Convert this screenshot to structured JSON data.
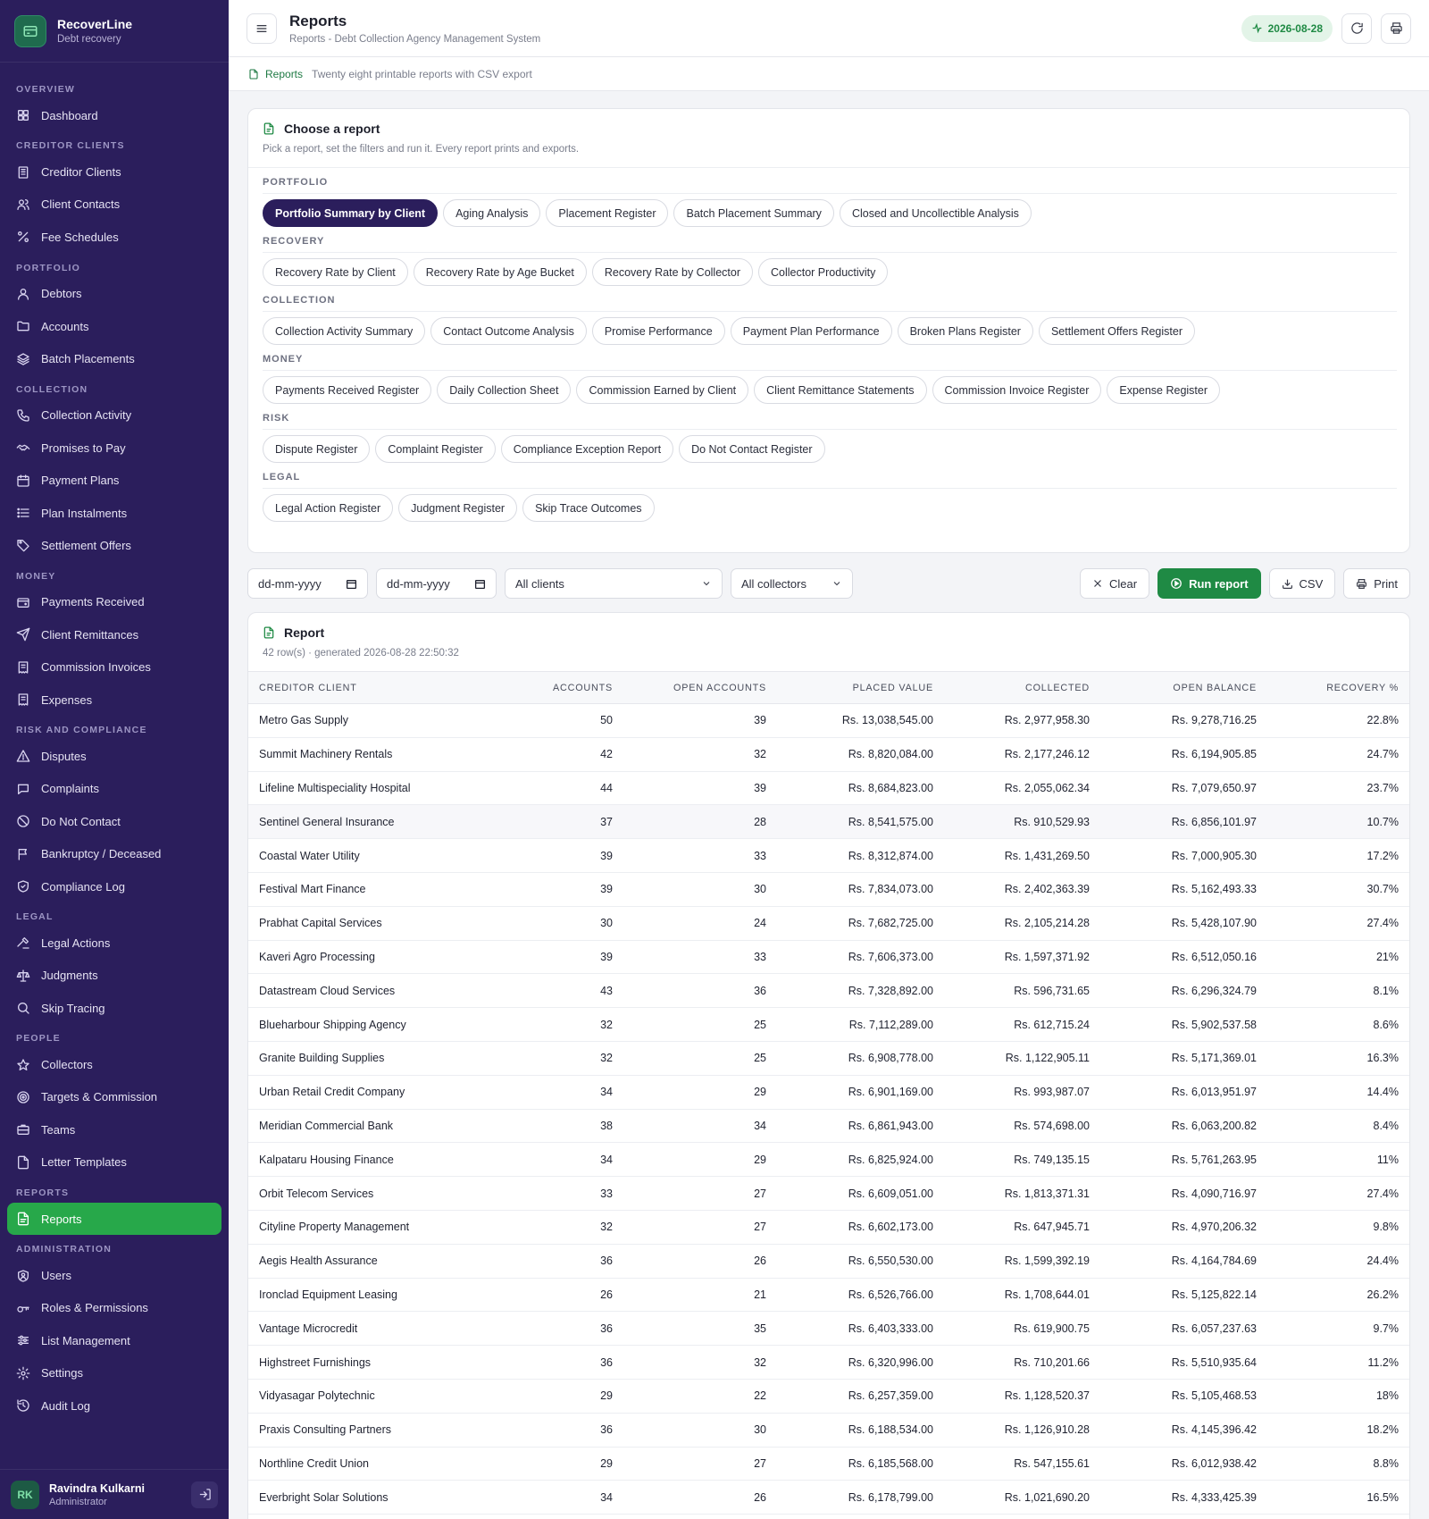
{
  "brand": {
    "name": "RecoverLine",
    "sub": "Debt recovery"
  },
  "nav": [
    {
      "section": "OVERVIEW",
      "items": [
        {
          "label": "Dashboard",
          "icon": "grid-icon"
        }
      ]
    },
    {
      "section": "CREDITOR CLIENTS",
      "items": [
        {
          "label": "Creditor Clients",
          "icon": "building-icon"
        },
        {
          "label": "Client Contacts",
          "icon": "users-icon"
        },
        {
          "label": "Fee Schedules",
          "icon": "percent-icon"
        }
      ]
    },
    {
      "section": "PORTFOLIO",
      "items": [
        {
          "label": "Debtors",
          "icon": "user-icon"
        },
        {
          "label": "Accounts",
          "icon": "folder-icon"
        },
        {
          "label": "Batch Placements",
          "icon": "layers-icon"
        }
      ]
    },
    {
      "section": "COLLECTION",
      "items": [
        {
          "label": "Collection Activity",
          "icon": "phone-icon"
        },
        {
          "label": "Promises to Pay",
          "icon": "handshake-icon"
        },
        {
          "label": "Payment Plans",
          "icon": "calendar-icon"
        },
        {
          "label": "Plan Instalments",
          "icon": "list-icon"
        },
        {
          "label": "Settlement Offers",
          "icon": "tag-icon"
        }
      ]
    },
    {
      "section": "MONEY",
      "items": [
        {
          "label": "Payments Received",
          "icon": "wallet-icon"
        },
        {
          "label": "Client Remittances",
          "icon": "send-icon"
        },
        {
          "label": "Commission Invoices",
          "icon": "receipt-icon"
        },
        {
          "label": "Expenses",
          "icon": "receipt-icon"
        }
      ]
    },
    {
      "section": "RISK AND COMPLIANCE",
      "items": [
        {
          "label": "Disputes",
          "icon": "alert-triangle-icon"
        },
        {
          "label": "Complaints",
          "icon": "message-icon"
        },
        {
          "label": "Do Not Contact",
          "icon": "ban-icon"
        },
        {
          "label": "Bankruptcy / Deceased",
          "icon": "flag-icon"
        },
        {
          "label": "Compliance Log",
          "icon": "shield-icon"
        }
      ]
    },
    {
      "section": "LEGAL",
      "items": [
        {
          "label": "Legal Actions",
          "icon": "gavel-icon"
        },
        {
          "label": "Judgments",
          "icon": "scale-icon"
        },
        {
          "label": "Skip Tracing",
          "icon": "search-icon"
        }
      ]
    },
    {
      "section": "PEOPLE",
      "items": [
        {
          "label": "Collectors",
          "icon": "star-icon"
        },
        {
          "label": "Targets & Commission",
          "icon": "target-icon"
        },
        {
          "label": "Teams",
          "icon": "briefcase-icon"
        },
        {
          "label": "Letter Templates",
          "icon": "file-icon"
        }
      ]
    },
    {
      "section": "REPORTS",
      "items": [
        {
          "label": "Reports",
          "icon": "report-icon",
          "active": true
        }
      ]
    },
    {
      "section": "ADMINISTRATION",
      "items": [
        {
          "label": "Users",
          "icon": "user-shield-icon"
        },
        {
          "label": "Roles & Permissions",
          "icon": "key-icon"
        },
        {
          "label": "List Management",
          "icon": "sliders-icon"
        },
        {
          "label": "Settings",
          "icon": "gear-icon"
        },
        {
          "label": "Audit Log",
          "icon": "history-icon"
        }
      ]
    }
  ],
  "user": {
    "initials": "RK",
    "name": "Ravindra Kulkarni",
    "role": "Administrator"
  },
  "header": {
    "title": "Reports",
    "subtitle": "Reports - Debt Collection Agency Management System",
    "date": "2026-08-28"
  },
  "crumb": {
    "section": "Reports",
    "desc": "Twenty eight printable reports with CSV export"
  },
  "chooser": {
    "title": "Choose a report",
    "subtitle": "Pick a report, set the filters and run it. Every report prints and exports.",
    "groups": [
      {
        "label": "PORTFOLIO",
        "reports": [
          "Portfolio Summary by Client",
          "Aging Analysis",
          "Placement Register",
          "Batch Placement Summary",
          "Closed and Uncollectible Analysis"
        ]
      },
      {
        "label": "RECOVERY",
        "reports": [
          "Recovery Rate by Client",
          "Recovery Rate by Age Bucket",
          "Recovery Rate by Collector",
          "Collector Productivity"
        ]
      },
      {
        "label": "COLLECTION",
        "reports": [
          "Collection Activity Summary",
          "Contact Outcome Analysis",
          "Promise Performance",
          "Payment Plan Performance",
          "Broken Plans Register",
          "Settlement Offers Register"
        ]
      },
      {
        "label": "MONEY",
        "reports": [
          "Payments Received Register",
          "Daily Collection Sheet",
          "Commission Earned by Client",
          "Client Remittance Statements",
          "Commission Invoice Register",
          "Expense Register"
        ]
      },
      {
        "label": "RISK",
        "reports": [
          "Dispute Register",
          "Complaint Register",
          "Compliance Exception Report",
          "Do Not Contact Register"
        ]
      },
      {
        "label": "LEGAL",
        "reports": [
          "Legal Action Register",
          "Judgment Register",
          "Skip Trace Outcomes"
        ]
      }
    ],
    "selected": "Portfolio Summary by Client"
  },
  "filters": {
    "from_placeholder": "dd-mm-yyyy",
    "to_placeholder": "dd-mm-yyyy",
    "client": "All clients",
    "collector": "All collectors",
    "clear": "Clear",
    "run": "Run report",
    "csv": "CSV",
    "print": "Print"
  },
  "report": {
    "title": "Report",
    "meta": "42 row(s) · generated 2026-08-28 22:50:32",
    "columns": [
      "CREDITOR CLIENT",
      "ACCOUNTS",
      "OPEN ACCOUNTS",
      "PLACED VALUE",
      "COLLECTED",
      "OPEN BALANCE",
      "RECOVERY %"
    ],
    "rows": [
      [
        "Metro Gas Supply",
        "50",
        "39",
        "Rs. 13,038,545.00",
        "Rs. 2,977,958.30",
        "Rs. 9,278,716.25",
        "22.8%"
      ],
      [
        "Summit Machinery Rentals",
        "42",
        "32",
        "Rs. 8,820,084.00",
        "Rs. 2,177,246.12",
        "Rs. 6,194,905.85",
        "24.7%"
      ],
      [
        "Lifeline Multispeciality Hospital",
        "44",
        "39",
        "Rs. 8,684,823.00",
        "Rs. 2,055,062.34",
        "Rs. 7,079,650.97",
        "23.7%"
      ],
      [
        "Sentinel General Insurance",
        "37",
        "28",
        "Rs. 8,541,575.00",
        "Rs. 910,529.93",
        "Rs. 6,856,101.97",
        "10.7%"
      ],
      [
        "Coastal Water Utility",
        "39",
        "33",
        "Rs. 8,312,874.00",
        "Rs. 1,431,269.50",
        "Rs. 7,000,905.30",
        "17.2%"
      ],
      [
        "Festival Mart Finance",
        "39",
        "30",
        "Rs. 7,834,073.00",
        "Rs. 2,402,363.39",
        "Rs. 5,162,493.33",
        "30.7%"
      ],
      [
        "Prabhat Capital Services",
        "30",
        "24",
        "Rs. 7,682,725.00",
        "Rs. 2,105,214.28",
        "Rs. 5,428,107.90",
        "27.4%"
      ],
      [
        "Kaveri Agro Processing",
        "39",
        "33",
        "Rs. 7,606,373.00",
        "Rs. 1,597,371.92",
        "Rs. 6,512,050.16",
        "21%"
      ],
      [
        "Datastream Cloud Services",
        "43",
        "36",
        "Rs. 7,328,892.00",
        "Rs. 596,731.65",
        "Rs. 6,296,324.79",
        "8.1%"
      ],
      [
        "Blueharbour Shipping Agency",
        "32",
        "25",
        "Rs. 7,112,289.00",
        "Rs. 612,715.24",
        "Rs. 5,902,537.58",
        "8.6%"
      ],
      [
        "Granite Building Supplies",
        "32",
        "25",
        "Rs. 6,908,778.00",
        "Rs. 1,122,905.11",
        "Rs. 5,171,369.01",
        "16.3%"
      ],
      [
        "Urban Retail Credit Company",
        "34",
        "29",
        "Rs. 6,901,169.00",
        "Rs. 993,987.07",
        "Rs. 6,013,951.97",
        "14.4%"
      ],
      [
        "Meridian Commercial Bank",
        "38",
        "34",
        "Rs. 6,861,943.00",
        "Rs. 574,698.00",
        "Rs. 6,063,200.82",
        "8.4%"
      ],
      [
        "Kalpataru Housing Finance",
        "34",
        "29",
        "Rs. 6,825,924.00",
        "Rs. 749,135.15",
        "Rs. 5,761,263.95",
        "11%"
      ],
      [
        "Orbit Telecom Services",
        "33",
        "27",
        "Rs. 6,609,051.00",
        "Rs. 1,813,371.31",
        "Rs. 4,090,716.97",
        "27.4%"
      ],
      [
        "Cityline Property Management",
        "32",
        "27",
        "Rs. 6,602,173.00",
        "Rs. 647,945.71",
        "Rs. 4,970,206.32",
        "9.8%"
      ],
      [
        "Aegis Health Assurance",
        "36",
        "26",
        "Rs. 6,550,530.00",
        "Rs. 1,599,392.19",
        "Rs. 4,164,784.69",
        "24.4%"
      ],
      [
        "Ironclad Equipment Leasing",
        "26",
        "21",
        "Rs. 6,526,766.00",
        "Rs. 1,708,644.01",
        "Rs. 5,125,822.14",
        "26.2%"
      ],
      [
        "Vantage Microcredit",
        "36",
        "35",
        "Rs. 6,403,333.00",
        "Rs. 619,900.75",
        "Rs. 6,057,237.63",
        "9.7%"
      ],
      [
        "Highstreet Furnishings",
        "36",
        "32",
        "Rs. 6,320,996.00",
        "Rs. 710,201.66",
        "Rs. 5,510,935.64",
        "11.2%"
      ],
      [
        "Vidyasagar Polytechnic",
        "29",
        "22",
        "Rs. 6,257,359.00",
        "Rs. 1,128,520.37",
        "Rs. 5,105,468.53",
        "18%"
      ],
      [
        "Praxis Consulting Partners",
        "36",
        "30",
        "Rs. 6,188,534.00",
        "Rs. 1,126,910.28",
        "Rs. 4,145,396.42",
        "18.2%"
      ],
      [
        "Northline Credit Union",
        "29",
        "27",
        "Rs. 6,185,568.00",
        "Rs. 547,155.61",
        "Rs. 6,012,938.42",
        "8.8%"
      ],
      [
        "Everbright Solar Solutions",
        "34",
        "26",
        "Rs. 6,178,799.00",
        "Rs. 1,021,690.20",
        "Rs. 4,333,425.39",
        "16.5%"
      ]
    ]
  },
  "colors": {
    "sidebar": "#2b1e5c",
    "accent": "#27a84a",
    "primary_button": "#1f8a44",
    "selected_chip": "#2b1e5c"
  }
}
